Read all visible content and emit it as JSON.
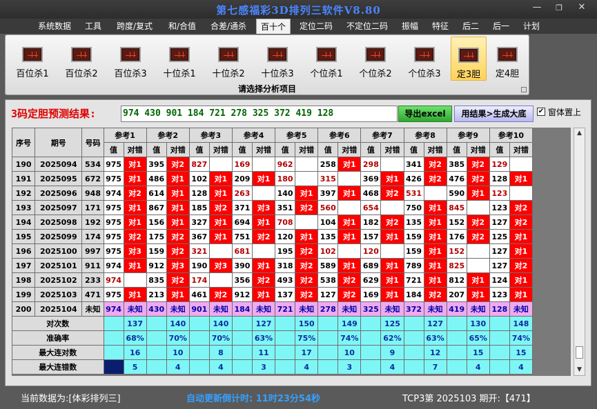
{
  "window": {
    "title": "第七感福彩3D排列三软件V8.80",
    "min": "—",
    "max": "❐",
    "close": "✕"
  },
  "menu": [
    {
      "label": "系统数据",
      "active": false
    },
    {
      "label": "工具",
      "active": false
    },
    {
      "label": "跨度/复式",
      "active": false
    },
    {
      "label": "和/合值",
      "active": false
    },
    {
      "label": "合差/通杀",
      "active": false
    },
    {
      "label": "百十个",
      "active": true
    },
    {
      "label": "定位二码",
      "active": false
    },
    {
      "label": "不定位二码",
      "active": false
    },
    {
      "label": "振幅",
      "active": false
    },
    {
      "label": "特征",
      "active": false
    },
    {
      "label": "后二",
      "active": false
    },
    {
      "label": "后一",
      "active": false
    },
    {
      "label": "计划",
      "active": false
    }
  ],
  "ribbon": {
    "group_label": "请选择分析项目",
    "buttons": [
      {
        "label": "百位杀1",
        "icon": "chart-icon",
        "selected": false
      },
      {
        "label": "百位杀2",
        "icon": "chart-icon",
        "selected": false
      },
      {
        "label": "百位杀3",
        "icon": "chart-icon",
        "selected": false
      },
      {
        "label": "十位杀1",
        "icon": "chart-icon",
        "selected": false
      },
      {
        "label": "十位杀2",
        "icon": "chart-icon",
        "selected": false
      },
      {
        "label": "十位杀3",
        "icon": "chart-icon",
        "selected": false
      },
      {
        "label": "个位杀1",
        "icon": "chart-icon",
        "selected": false
      },
      {
        "label": "个位杀2",
        "icon": "chart-icon",
        "selected": false
      },
      {
        "label": "个位杀3",
        "icon": "chart-icon",
        "selected": false
      },
      {
        "label": "定3胆",
        "icon": "chart-icon",
        "selected": true
      },
      {
        "label": "定4胆",
        "icon": "chart-icon",
        "selected": false
      }
    ]
  },
  "prediction": {
    "label": "3码定胆预测结果:",
    "value": "974 430 901 184 721 278 325 372 419 128",
    "export_button": "导出excel",
    "generate_button": "用结果>生成大底",
    "on_top_check": "✔",
    "on_top_label": "窗体置上"
  },
  "table": {
    "col_seq": "序号",
    "col_period": "期号",
    "col_number": "号码",
    "sub_value": "值",
    "sub_result": "对错",
    "refs": [
      "参考1",
      "参考2",
      "参考3",
      "参考4",
      "参考5",
      "参考6",
      "参考7",
      "参考8",
      "参考9",
      "参考10"
    ],
    "rows": [
      {
        "seq": "190",
        "period": "2025094",
        "number": "534",
        "refs": [
          [
            "975",
            "对1"
          ],
          [
            "395",
            "对2"
          ],
          [
            "827",
            ""
          ],
          [
            "169",
            ""
          ],
          [
            "962",
            ""
          ],
          [
            "258",
            "对1"
          ],
          [
            "298",
            ""
          ],
          [
            "341",
            "对2"
          ],
          [
            "385",
            "对2"
          ],
          [
            "129",
            ""
          ]
        ]
      },
      {
        "seq": "191",
        "period": "2025095",
        "number": "672",
        "refs": [
          [
            "975",
            "对1"
          ],
          [
            "486",
            "对1"
          ],
          [
            "102",
            "对1"
          ],
          [
            "209",
            "对1"
          ],
          [
            "180",
            ""
          ],
          [
            "315",
            ""
          ],
          [
            "369",
            "对1"
          ],
          [
            "426",
            "对2"
          ],
          [
            "476",
            "对2"
          ],
          [
            "128",
            "对1"
          ]
        ]
      },
      {
        "seq": "192",
        "period": "2025096",
        "number": "948",
        "refs": [
          [
            "974",
            "对2"
          ],
          [
            "614",
            "对1"
          ],
          [
            "128",
            "对1"
          ],
          [
            "263",
            ""
          ],
          [
            "140",
            "对1"
          ],
          [
            "397",
            "对1"
          ],
          [
            "468",
            "对2"
          ],
          [
            "531",
            ""
          ],
          [
            "590",
            "对1"
          ],
          [
            "123",
            ""
          ]
        ]
      },
      {
        "seq": "193",
        "period": "2025097",
        "number": "171",
        "refs": [
          [
            "975",
            "对1"
          ],
          [
            "867",
            "对1"
          ],
          [
            "185",
            "对2"
          ],
          [
            "371",
            "对3"
          ],
          [
            "351",
            "对2"
          ],
          [
            "560",
            ""
          ],
          [
            "654",
            ""
          ],
          [
            "750",
            "对1"
          ],
          [
            "845",
            ""
          ],
          [
            "123",
            "对2"
          ]
        ]
      },
      {
        "seq": "194",
        "period": "2025098",
        "number": "192",
        "refs": [
          [
            "975",
            "对1"
          ],
          [
            "156",
            "对1"
          ],
          [
            "327",
            "对1"
          ],
          [
            "694",
            "对1"
          ],
          [
            "708",
            ""
          ],
          [
            "104",
            "对1"
          ],
          [
            "182",
            "对2"
          ],
          [
            "135",
            "对1"
          ],
          [
            "152",
            "对2"
          ],
          [
            "127",
            "对2"
          ]
        ]
      },
      {
        "seq": "195",
        "period": "2025099",
        "number": "174",
        "refs": [
          [
            "975",
            "对2"
          ],
          [
            "175",
            "对2"
          ],
          [
            "367",
            "对1"
          ],
          [
            "751",
            "对2"
          ],
          [
            "120",
            "对1"
          ],
          [
            "135",
            "对1"
          ],
          [
            "157",
            "对1"
          ],
          [
            "159",
            "对1"
          ],
          [
            "176",
            "对2"
          ],
          [
            "125",
            "对1"
          ]
        ]
      },
      {
        "seq": "196",
        "period": "2025100",
        "number": "997",
        "refs": [
          [
            "975",
            "对3"
          ],
          [
            "159",
            "对2"
          ],
          [
            "321",
            ""
          ],
          [
            "681",
            ""
          ],
          [
            "195",
            "对2"
          ],
          [
            "102",
            ""
          ],
          [
            "120",
            ""
          ],
          [
            "159",
            "对1"
          ],
          [
            "152",
            ""
          ],
          [
            "127",
            "对1"
          ]
        ]
      },
      {
        "seq": "197",
        "period": "2025101",
        "number": "911",
        "refs": [
          [
            "974",
            "对1"
          ],
          [
            "912",
            "对3"
          ],
          [
            "190",
            "对3"
          ],
          [
            "390",
            "对1"
          ],
          [
            "318",
            "对2"
          ],
          [
            "589",
            "对1"
          ],
          [
            "689",
            "对1"
          ],
          [
            "789",
            "对1"
          ],
          [
            "825",
            ""
          ],
          [
            "127",
            "对2"
          ]
        ]
      },
      {
        "seq": "198",
        "period": "2025102",
        "number": "233",
        "refs": [
          [
            "974",
            ""
          ],
          [
            "835",
            "对2"
          ],
          [
            "174",
            ""
          ],
          [
            "356",
            "对2"
          ],
          [
            "493",
            "对2"
          ],
          [
            "538",
            "对2"
          ],
          [
            "629",
            "对1"
          ],
          [
            "721",
            "对1"
          ],
          [
            "812",
            "对1"
          ],
          [
            "124",
            "对1"
          ]
        ]
      },
      {
        "seq": "199",
        "period": "2025103",
        "number": "471",
        "refs": [
          [
            "975",
            "对1"
          ],
          [
            "213",
            "对1"
          ],
          [
            "461",
            "对2"
          ],
          [
            "912",
            "对1"
          ],
          [
            "137",
            "对2"
          ],
          [
            "127",
            "对2"
          ],
          [
            "169",
            "对1"
          ],
          [
            "184",
            "对2"
          ],
          [
            "207",
            "对1"
          ],
          [
            "123",
            "对1"
          ]
        ]
      },
      {
        "seq": "200",
        "period": "2025104",
        "number": "未知",
        "unknown": true,
        "refs": [
          [
            "974",
            "未知"
          ],
          [
            "430",
            "未知"
          ],
          [
            "901",
            "未知"
          ],
          [
            "184",
            "未知"
          ],
          [
            "721",
            "未知"
          ],
          [
            "278",
            "未知"
          ],
          [
            "325",
            "未知"
          ],
          [
            "372",
            "未知"
          ],
          [
            "419",
            "未知"
          ],
          [
            "128",
            "未知"
          ]
        ]
      }
    ],
    "stats": [
      {
        "label": "对次数",
        "values": [
          "137",
          "140",
          "140",
          "127",
          "150",
          "149",
          "125",
          "127",
          "130",
          "148"
        ]
      },
      {
        "label": "准确率",
        "values": [
          "68%",
          "70%",
          "70%",
          "63%",
          "75%",
          "74%",
          "62%",
          "63%",
          "65%",
          "74%"
        ]
      },
      {
        "label": "最大连对数",
        "values": [
          "16",
          "10",
          "8",
          "11",
          "17",
          "10",
          "9",
          "12",
          "15",
          "15"
        ]
      },
      {
        "label": "最大连错数",
        "values": [
          "5",
          "4",
          "4",
          "3",
          "4",
          "3",
          "4",
          "7",
          "4",
          "4"
        ]
      }
    ]
  },
  "status": {
    "data_source": "当前数据为:[体彩排列三]",
    "countdown": "自动更新倒计时:  11时23分54秒",
    "latest": "TCP3第 2025103 期开:【471】"
  },
  "colors": {
    "accent_title": "#4a86ff",
    "correct_mark": "#ff0000",
    "unknown_row": "#efaaef",
    "stats_row": "#7ff6f6",
    "prediction_text": "#006400"
  }
}
